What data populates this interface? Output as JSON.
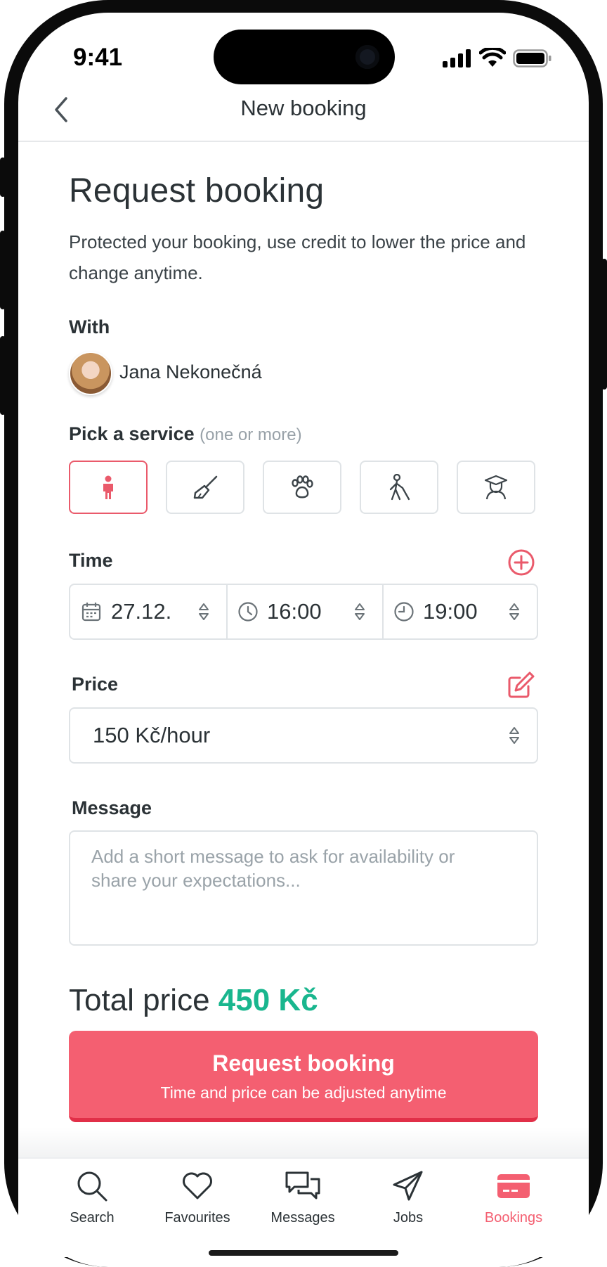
{
  "status_bar": {
    "time": "9:41"
  },
  "nav": {
    "title": "New booking",
    "back_icon": "chevron-left-icon"
  },
  "header": {
    "title": "Request booking",
    "description": "Protected your booking, use credit to lower the price and change anytime."
  },
  "with": {
    "label": "With",
    "name": "Jana Nekonečná"
  },
  "services": {
    "label": "Pick a service",
    "hint": "(one or more)",
    "items": [
      {
        "icon": "child-icon",
        "selected": true
      },
      {
        "icon": "broom-icon",
        "selected": false
      },
      {
        "icon": "paw-icon",
        "selected": false
      },
      {
        "icon": "elderly-care-icon",
        "selected": false
      },
      {
        "icon": "graduate-icon",
        "selected": false
      }
    ]
  },
  "time": {
    "label": "Time",
    "date": "27.12.",
    "from": "16:00",
    "to": "19:00"
  },
  "price": {
    "label": "Price",
    "value": "150 Kč/hour"
  },
  "message": {
    "label": "Message",
    "placeholder": "Add a short message to ask for availability or share your expectations..."
  },
  "total": {
    "label": "Total price",
    "amount": "450 Kč"
  },
  "cta": {
    "title": "Request booking",
    "subtitle": "Time and price can be adjusted anytime"
  },
  "tabs": [
    {
      "label": "Search",
      "icon": "search-icon",
      "active": false
    },
    {
      "label": "Favourites",
      "icon": "heart-icon",
      "active": false
    },
    {
      "label": "Messages",
      "icon": "chat-bubbles-icon",
      "active": false
    },
    {
      "label": "Jobs",
      "icon": "paper-plane-icon",
      "active": false
    },
    {
      "label": "Bookings",
      "icon": "card-icon",
      "active": true
    }
  ],
  "colors": {
    "accent": "#f45f71",
    "accent_dark": "#e12f48",
    "price_green": "#19b68e",
    "text": "#2b3236",
    "muted": "#98a1a8",
    "border": "#dfe3e6"
  }
}
